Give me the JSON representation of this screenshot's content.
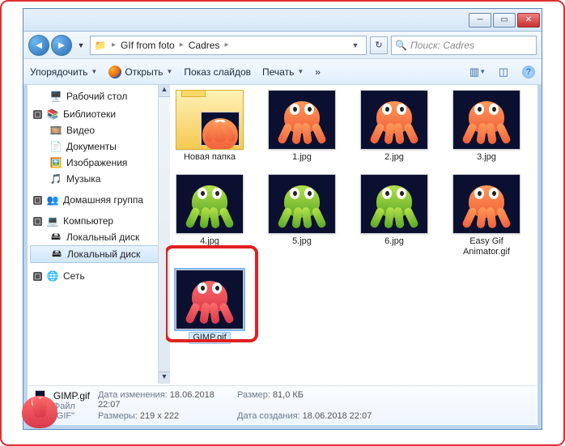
{
  "breadcrumb": {
    "seg1": "GIf from foto",
    "seg2": "Cadres"
  },
  "search": {
    "placeholder": "Поиск: Cadres"
  },
  "toolbar": {
    "organize": "Упорядочить",
    "open": "Открыть",
    "slideshow": "Показ слайдов",
    "print": "Печать",
    "help_tip": "?"
  },
  "sidebar": {
    "desktop": "Рабочий стол",
    "libraries": "Библиотеки",
    "video": "Видео",
    "documents": "Документы",
    "pictures": "Изображения",
    "music": "Музыка",
    "homegroup": "Домашняя группа",
    "computer": "Компьютер",
    "disk_c": "Локальный диск",
    "disk_d": "Локальный диск",
    "network": "Сеть"
  },
  "files": {
    "folder": "Новая папка",
    "f1": "1.jpg",
    "f2": "2.jpg",
    "f3": "3.jpg",
    "f4": "4.jpg",
    "f5": "5.jpg",
    "f6": "6.jpg",
    "easy": "Easy Gif Animator.gif",
    "gimp": "GIMP.gif"
  },
  "details": {
    "name": "GIMP.gif",
    "type_label": "Файл \"GIF\"",
    "mod_label": "Дата изменения:",
    "mod_val": "18.06.2018 22:07",
    "dim_label": "Размеры:",
    "dim_val": "219 x 222",
    "size_label": "Размер:",
    "size_val": "81,0 КБ",
    "created_label": "Дата создания:",
    "created_val": "18.06.2018 22:07"
  },
  "colors": {
    "accent": "#3a7ac0",
    "highlight_red": "#e02020"
  }
}
